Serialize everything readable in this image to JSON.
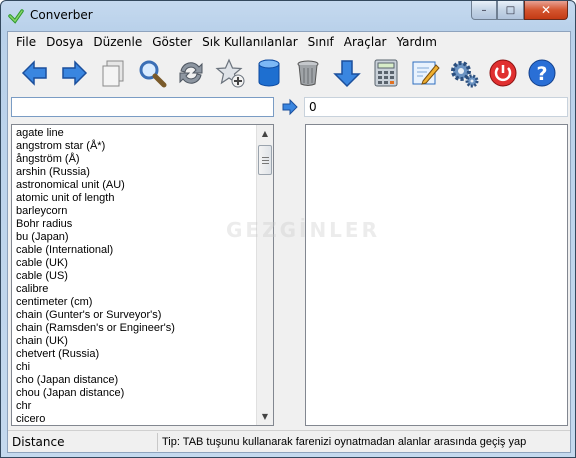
{
  "window": {
    "title": "Converber",
    "minimize": "–",
    "maximize": "□",
    "close": "✕"
  },
  "menu": [
    {
      "label": "File",
      "name": "menu-file"
    },
    {
      "label": "Dosya",
      "name": "menu-dosya"
    },
    {
      "label": "Düzenle",
      "name": "menu-duzenle"
    },
    {
      "label": "Göster",
      "name": "menu-goster"
    },
    {
      "label": "Sık Kullanılanlar",
      "name": "menu-sik-kullanilanlar"
    },
    {
      "label": "Sınıf",
      "name": "menu-sinif"
    },
    {
      "label": "Araçlar",
      "name": "menu-araclar"
    },
    {
      "label": "Yardım",
      "name": "menu-yardim"
    }
  ],
  "toolbar": [
    {
      "icon": "back-arrow-icon",
      "color": "#2f7ad9"
    },
    {
      "icon": "forward-arrow-icon",
      "color": "#2f7ad9"
    },
    {
      "icon": "copy-icon",
      "color": "#d8d8d8"
    },
    {
      "icon": "search-icon",
      "color": "#3b6fb6"
    },
    {
      "icon": "swap-icon",
      "color": "#7d8794"
    },
    {
      "icon": "add-favorite-icon",
      "color": "#b0b6be"
    },
    {
      "icon": "database-icon",
      "color": "#1e6fd0"
    },
    {
      "icon": "trash-icon",
      "color": "#8e9296"
    },
    {
      "icon": "download-arrow-icon",
      "color": "#2f7ad9"
    },
    {
      "icon": "calculator-icon",
      "color": "#8a9aa8"
    },
    {
      "icon": "edit-icon",
      "color": "#2f7ad9"
    },
    {
      "icon": "settings-gear-icon",
      "color": "#5e87b5"
    },
    {
      "icon": "power-icon",
      "color": "#d82424"
    },
    {
      "icon": "help-icon",
      "color": "#2a6fd6"
    }
  ],
  "converter": {
    "from_value": "",
    "to_value": "0"
  },
  "units": [
    "agate line",
    "angstrom star (Å*)",
    "ångström (Å)",
    "arshin (Russia)",
    "astronomical unit (AU)",
    "atomic unit of length",
    "barleycorn",
    "Bohr radius",
    "bu (Japan)",
    "cable (International)",
    "cable (UK)",
    "cable (US)",
    "calibre",
    "centimeter (cm)",
    "chain (Gunter's or Surveyor's)",
    "chain (Ramsden's or Engineer's)",
    "chain (UK)",
    "chetvert (Russia)",
    "chi",
    "cho (Japan distance)",
    "chou (Japan distance)",
    "chr",
    "cicero"
  ],
  "status": {
    "category": "Distance",
    "tip": "Tip: TAB tuşunu kullanarak farenizi oynatmadan alanlar arasında geçiş yap"
  },
  "watermark": "GEZGİNLER"
}
